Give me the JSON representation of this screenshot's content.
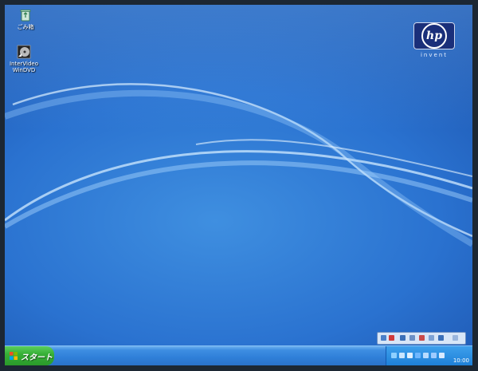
{
  "desktop": {
    "icons": [
      {
        "label": "ごみ箱"
      },
      {
        "label": "InterVideo WinDVD"
      }
    ]
  },
  "brand": {
    "logo_text": "hp",
    "tagline": "invent"
  },
  "taskbar": {
    "start_label": "スタート",
    "clock": "10:00"
  },
  "colors": {
    "desktop_blue": "#2a72d0",
    "taskbar_blue": "#2f7fd8",
    "start_green": "#37b037",
    "hp_navy": "#1a2f7a"
  }
}
